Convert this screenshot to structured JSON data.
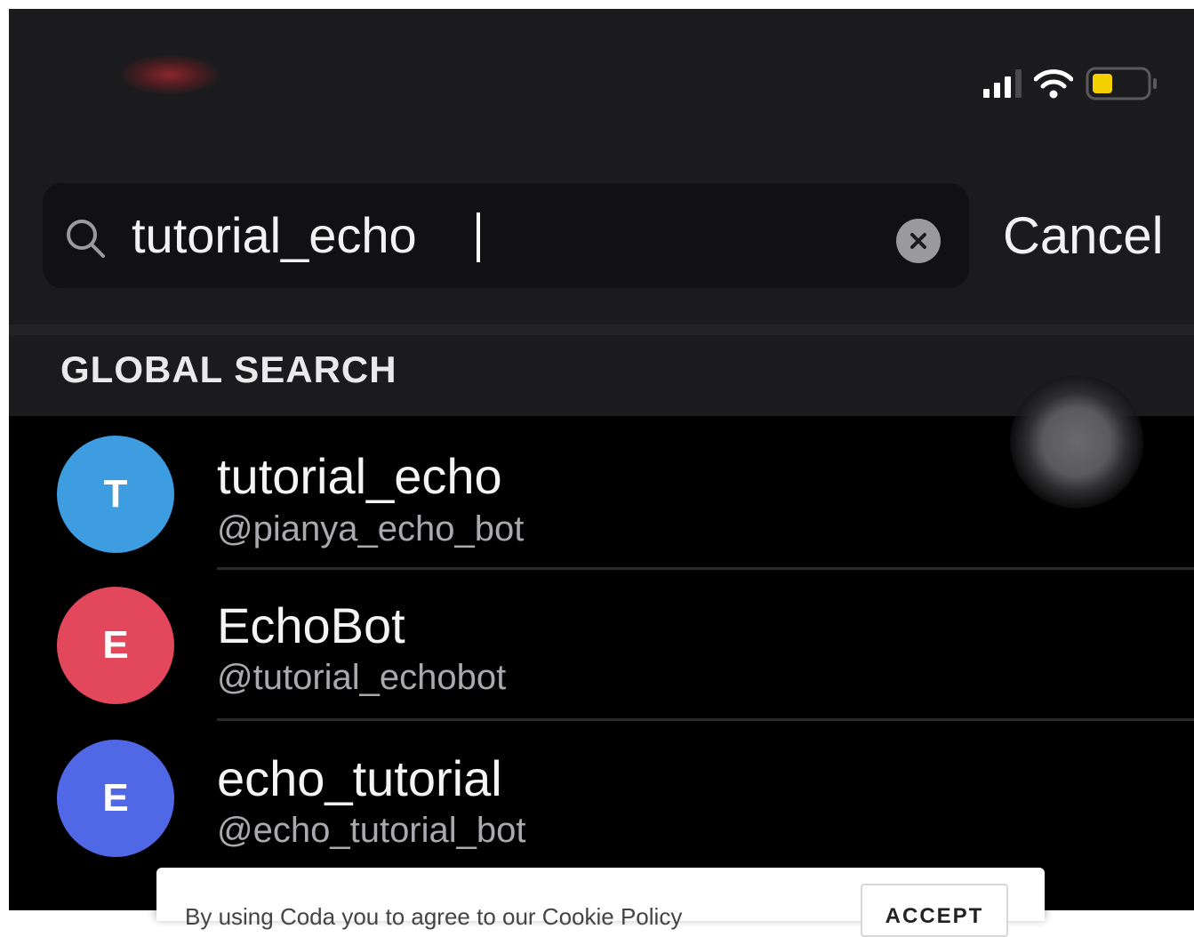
{
  "status_bar": {
    "signal_icon": "signal-bars-icon",
    "wifi_icon": "wifi-icon",
    "battery_icon": "battery-low-icon",
    "battery_color": "#f5d000"
  },
  "search": {
    "value": "tutorial_echo",
    "search_icon": "magnifier-icon",
    "clear_icon": "clear-x-icon",
    "cancel_label": "Cancel"
  },
  "section": {
    "header": "GLOBAL SEARCH"
  },
  "results": [
    {
      "initial": "T",
      "title": "tutorial_echo",
      "username": "@pianya_echo_bot",
      "color": "#3d9de0"
    },
    {
      "initial": "E",
      "title": "EchoBot",
      "username": "@tutorial_echobot",
      "color": "#e2475b"
    },
    {
      "initial": "E",
      "title": "echo_tutorial",
      "username": "@echo_tutorial_bot",
      "color": "#5067e6"
    }
  ],
  "cookie_banner": {
    "text": "By using Coda you to agree to our Cookie Policy",
    "accept_label": "ACCEPT"
  }
}
